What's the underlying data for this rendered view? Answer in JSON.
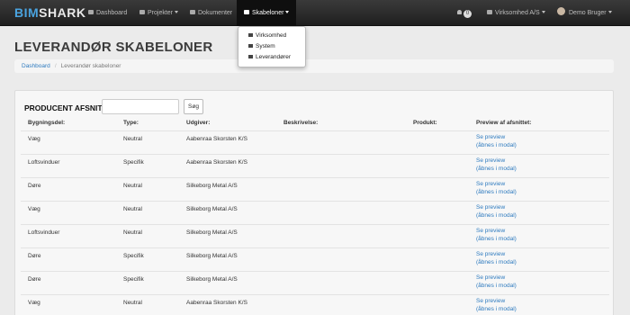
{
  "brand": {
    "part1": "BIM",
    "part2": "SHARK"
  },
  "nav": {
    "items": [
      {
        "label": "Dashboard",
        "icon": "dashboard-icon"
      },
      {
        "label": "Projekter",
        "icon": "folder-icon"
      },
      {
        "label": "Dokumenter",
        "icon": "folder-icon"
      },
      {
        "label": "Skabeloner",
        "icon": "document-icon",
        "active": true
      }
    ],
    "badge_count": "0",
    "company": "Virksomhed A/S",
    "user": "Demo Bruger"
  },
  "dropdown": {
    "items": [
      {
        "label": "Virksomhed",
        "icon": "home-icon"
      },
      {
        "label": "System",
        "icon": "table-icon"
      },
      {
        "label": "Leverandører",
        "icon": "truck-icon"
      }
    ]
  },
  "page": {
    "title": "LEVERANDØR SKABELONER"
  },
  "breadcrumb": {
    "home": "Dashboard",
    "current": "Leverandør skabeloner"
  },
  "filter": {
    "label": "PRODUCENT AFSNIT",
    "input_value": "",
    "button": "Søg"
  },
  "table": {
    "columns": [
      "Bygningsdel:",
      "Type:",
      "Udgiver:",
      "Beskrivelse:",
      "Produkt:",
      "Preview af afsnittet:"
    ],
    "preview_label": "Se preview",
    "preview_modal_label": "(åbnes i modal)",
    "rows": [
      {
        "bygningsdel": "Væg",
        "type": "Neutral",
        "udgiver": "Aabenraa Skorsten K/S"
      },
      {
        "bygningsdel": "Loftsvinduer",
        "type": "Specifik",
        "udgiver": "Aabenraa Skorsten K/S"
      },
      {
        "bygningsdel": "Døre",
        "type": "Neutral",
        "udgiver": "Silkeborg Metal A/S"
      },
      {
        "bygningsdel": "Væg",
        "type": "Neutral",
        "udgiver": "Silkeborg Metal A/S"
      },
      {
        "bygningsdel": "Loftsvinduer",
        "type": "Neutral",
        "udgiver": "Silkeborg Metal A/S"
      },
      {
        "bygningsdel": "Døre",
        "type": "Specifik",
        "udgiver": "Silkeborg Metal A/S"
      },
      {
        "bygningsdel": "Døre",
        "type": "Specifik",
        "udgiver": "Silkeborg Metal A/S"
      },
      {
        "bygningsdel": "Væg",
        "type": "Neutral",
        "udgiver": "Aabenraa Skorsten K/S"
      }
    ]
  }
}
